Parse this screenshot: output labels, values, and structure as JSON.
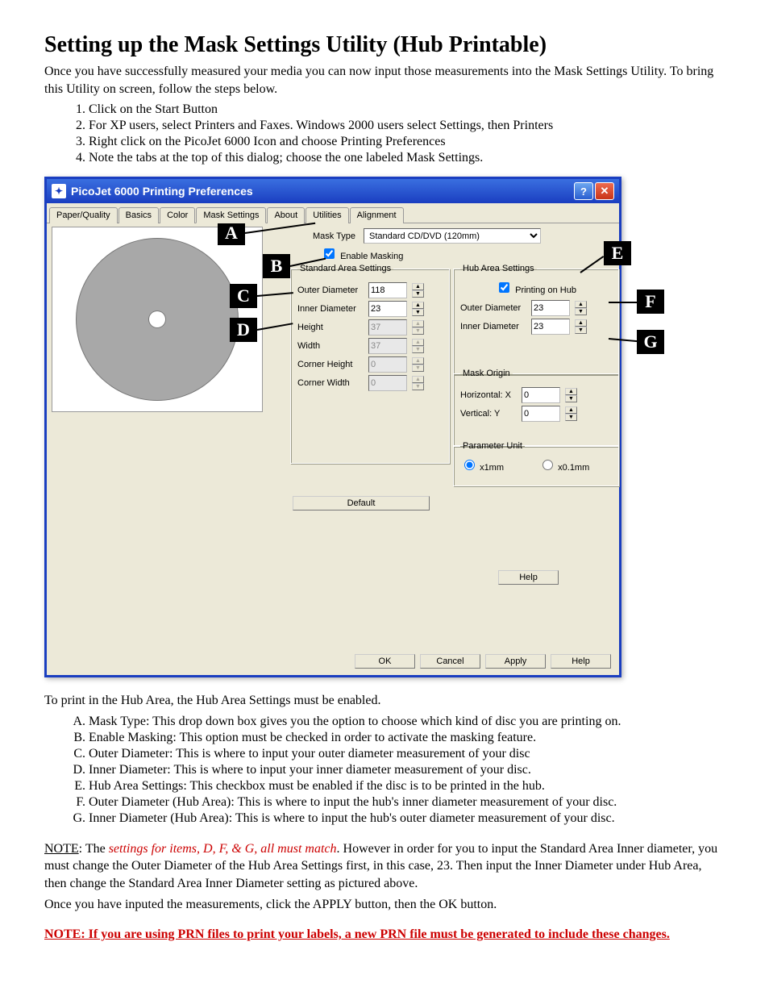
{
  "doc": {
    "title": "Setting up the Mask Settings Utility (Hub Printable)",
    "intro": "Once you have successfully measured your media you can now input those measurements into the Mask Settings Utility.  To bring this Utility on screen, follow the steps below.",
    "steps": {
      "s1": "Click on the Start Button",
      "s2": "For XP users, select Printers and Faxes.  Windows 2000 users select Settings, then Printers",
      "s3": "Right click on the PicoJet 6000 Icon and choose Printing Preferences",
      "s4": "Note the tabs at the top of this dialog; choose the one labeled Mask Settings."
    },
    "mid_para": "To print in the Hub Area, the Hub Area Settings must be enabled.",
    "items": {
      "A": "Mask Type:  This drop down box gives you the option to choose which kind of disc you are printing on.",
      "B": "Enable Masking:  This option must be checked in order to activate the masking feature.",
      "C": "Outer Diameter:  This is where to input your outer diameter measurement of your disc",
      "D": "Inner Diameter:  This is where to input your inner diameter measurement of your disc.",
      "E": "Hub Area Settings:  This checkbox must be enabled if the disc is to be printed in the hub.",
      "F": "Outer Diameter (Hub Area):  This is where to input the hub's inner diameter measurement of your disc.",
      "G": "Inner Diameter (Hub Area):  This is where to input the hub's outer diameter measurement of your disc."
    },
    "note1_prefix": "NOTE",
    "note1_colon": ":  The ",
    "note1_red": "settings for items, D, F, & G, all must match",
    "note1_rest": ".  However in order for you to input the Standard Area Inner diameter, you must change the Outer Diameter of the Hub Area Settings first, in this case, 23.  Then input the Inner Diameter under Hub Area, then change the Standard Area Inner Diameter setting as pictured above.",
    "note1_line2": "Once you have inputed the measurements, click the APPLY button, then the OK button.",
    "note2": "NOTE:   If you are using PRN files to print your labels, a new PRN file must be generated to include these changes."
  },
  "dialog": {
    "title": "PicoJet 6000 Printing Preferences",
    "tabs": {
      "t1": "Paper/Quality",
      "t2": "Basics",
      "t3": "Color",
      "t4": "Mask Settings",
      "t5": "About",
      "t6": "Utilities",
      "t7": "Alignment"
    },
    "mask_type_label": "Mask Type",
    "mask_type_value": "Standard CD/DVD (120mm)",
    "enable_masking": "Enable Masking",
    "standard": {
      "legend": "Standard Area Settings",
      "outer": "Outer Diameter",
      "outer_val": "118",
      "inner": "Inner Diameter",
      "inner_val": "23",
      "height": "Height",
      "height_val": "37",
      "width": "Width",
      "width_val": "37",
      "ch": "Corner Height",
      "ch_val": "0",
      "cw": "Corner Width",
      "cw_val": "0"
    },
    "hub": {
      "legend": "Hub Area Settings",
      "print_on_hub": "Printing on Hub",
      "outer": "Outer Diameter",
      "outer_val": "23",
      "inner": "Inner Diameter",
      "inner_val": "23"
    },
    "origin": {
      "legend": "Mask Origin",
      "hx": "Horizontal: X",
      "hx_val": "0",
      "vy": "Vertical: Y",
      "vy_val": "0"
    },
    "punit": {
      "legend": "Parameter Unit",
      "x1": "x1mm",
      "x01": "x0.1mm"
    },
    "default_btn": "Default",
    "help_btn": "Help",
    "ok": "OK",
    "cancel": "Cancel",
    "apply": "Apply",
    "help2": "Help"
  },
  "callouts": {
    "A": "A",
    "B": "B",
    "C": "C",
    "D": "D",
    "E": "E",
    "F": "F",
    "G": "G"
  }
}
